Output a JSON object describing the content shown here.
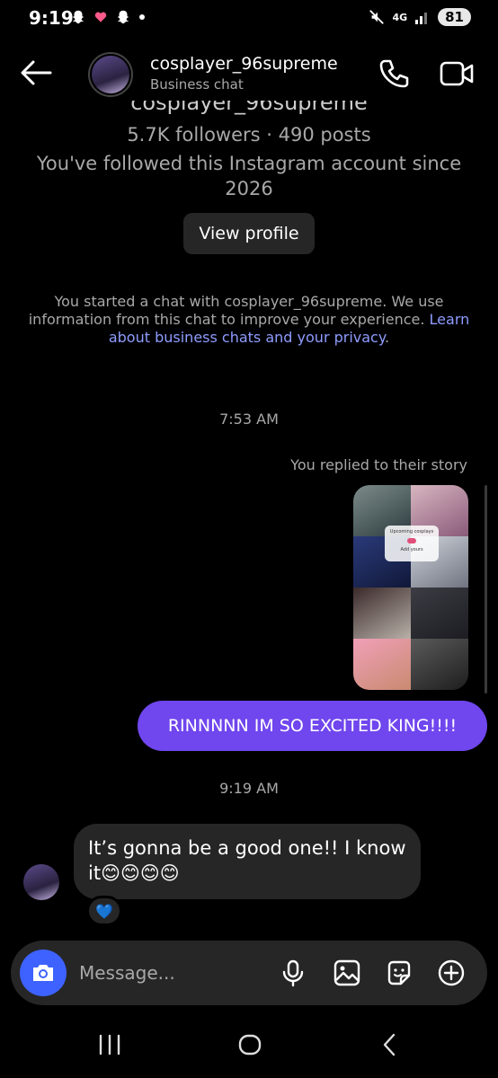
{
  "status_bar": {
    "time": "9:19",
    "network": "4G",
    "battery": "81"
  },
  "header": {
    "username": "cosplayer_96supreme",
    "subtitle": "Business chat"
  },
  "profile": {
    "name_cut": "cosplayer_96supreme",
    "stats": "5.7K followers · 490 posts",
    "followed_since": "You've followed this Instagram account since 2026",
    "view_profile_label": "View profile"
  },
  "notice": {
    "text": "You started a chat with cosplayer_96supreme. We use information from this chat to improve your experience. ",
    "link": "Learn about business chats and your privacy",
    "end": "."
  },
  "messages": {
    "timestamp_1": "7:53 AM",
    "story_reply_label": "You replied to their story",
    "story_sticker_title": "Upcoming cosplays",
    "story_sticker_cta": "Add yours",
    "outgoing_text": "RINNNNN IM SO EXCITED KING!!!!",
    "timestamp_2": "9:19 AM",
    "incoming_text": "It’s gonna be a good one!! I know it😊😊😊😊",
    "reaction": "💙"
  },
  "composer": {
    "placeholder": "Message..."
  },
  "colors": {
    "accent_purple": "#7046ee",
    "camera_blue": "#3d62ff",
    "link_blue": "#8f9cff",
    "bubble_gray": "#262626"
  }
}
